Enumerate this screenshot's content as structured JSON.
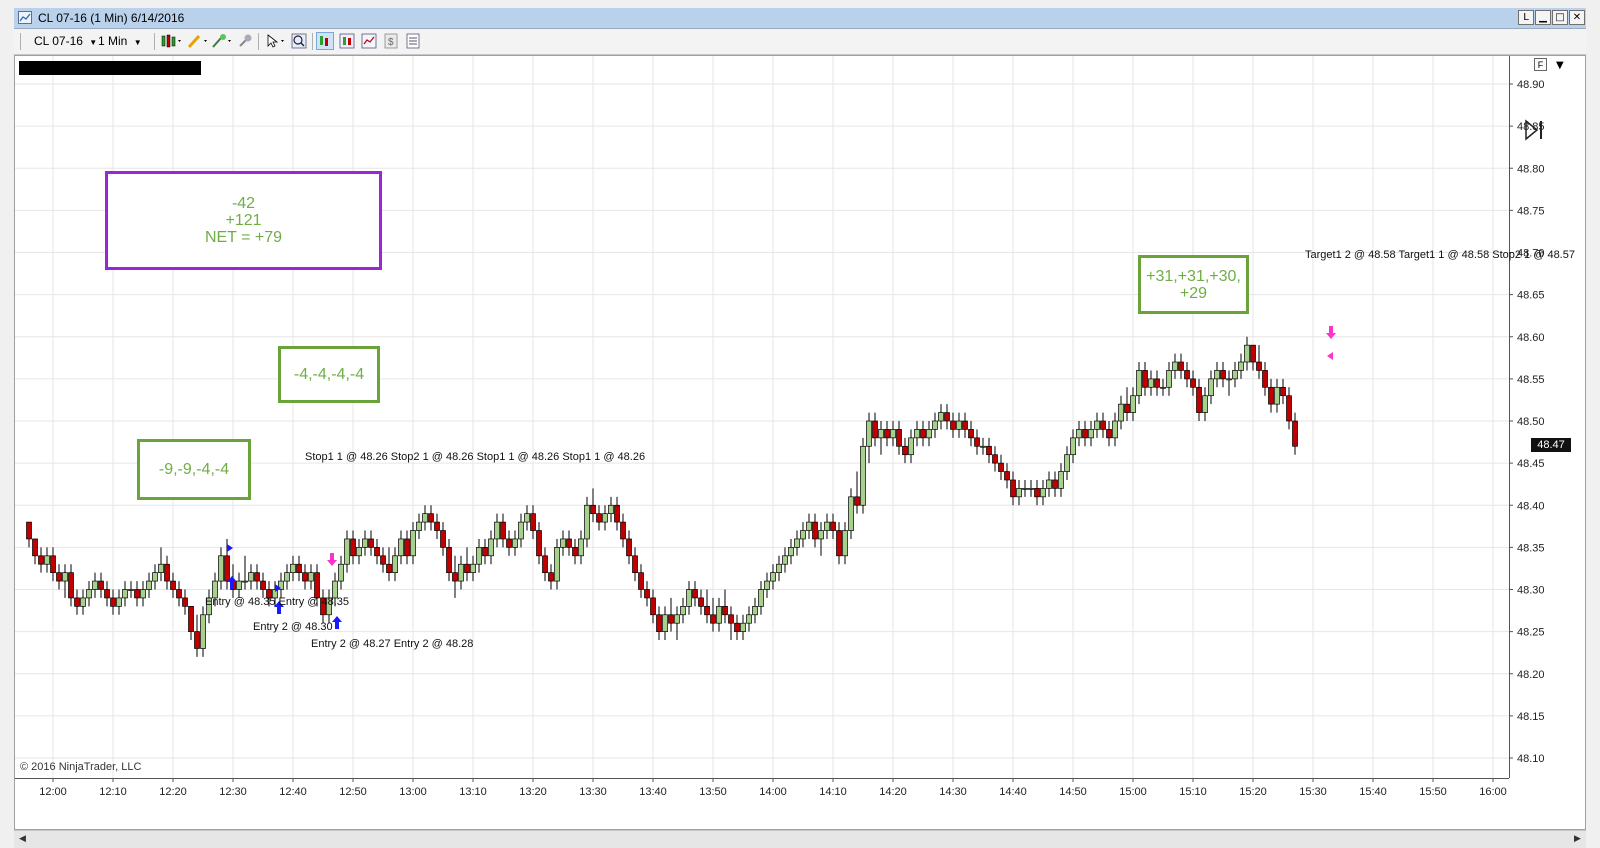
{
  "window": {
    "title": "CL 07-16 (1 Min)  6/14/2016",
    "buttons": {
      "link": "L",
      "minimize": "▁",
      "maximize": "□",
      "close": "✕"
    }
  },
  "toolbar": {
    "instrument": "CL 07-16",
    "interval": "1 Min",
    "icons": [
      "bar-type-icon",
      "pencil-draw-icon",
      "magic-wand-icon",
      "pin-icon",
      "cursor-select-icon",
      "zoom-icon",
      "data-box-icon",
      "chart-style-icon",
      "indicator-icon",
      "strategy-icon",
      "properties-icon"
    ]
  },
  "chart": {
    "copyright": "© 2016 NinjaTrader, LLC",
    "current_price": "48.47",
    "format_button": "F",
    "y_ticks": [
      "48.90",
      "48.85",
      "48.80",
      "48.75",
      "48.70",
      "48.65",
      "48.60",
      "48.55",
      "48.50",
      "48.45",
      "48.40",
      "48.35",
      "48.30",
      "48.25",
      "48.20",
      "48.15",
      "48.10"
    ],
    "x_ticks": [
      "12:00",
      "12:10",
      "12:20",
      "12:30",
      "12:40",
      "12:50",
      "13:00",
      "13:10",
      "13:20",
      "13:30",
      "13:40",
      "13:50",
      "14:00",
      "14:10",
      "14:20",
      "14:30",
      "14:40",
      "14:50",
      "15:00",
      "15:10",
      "15:20",
      "15:30",
      "15:40",
      "15:50",
      "16:00"
    ],
    "colors": {
      "up": "#a8d08d",
      "down": "#c00000",
      "grid": "#e6e6e6",
      "entry": "#1a1aff",
      "exit": "#ff33cc"
    }
  },
  "chart_data": {
    "type": "candlestick",
    "x_unit": "minute bars, starting 11:56",
    "ylim": [
      48.08,
      48.92
    ],
    "candles": [
      [
        48.38,
        48.38,
        48.35,
        48.36
      ],
      [
        48.36,
        48.36,
        48.33,
        48.34
      ],
      [
        48.34,
        48.35,
        48.32,
        48.33
      ],
      [
        48.33,
        48.35,
        48.32,
        48.34
      ],
      [
        48.34,
        48.35,
        48.31,
        48.32
      ],
      [
        48.32,
        48.33,
        48.3,
        48.31
      ],
      [
        48.31,
        48.33,
        48.29,
        48.32
      ],
      [
        48.32,
        48.33,
        48.28,
        48.29
      ],
      [
        48.29,
        48.3,
        48.27,
        48.28
      ],
      [
        48.28,
        48.3,
        48.27,
        48.29
      ],
      [
        48.29,
        48.31,
        48.28,
        48.3
      ],
      [
        48.3,
        48.32,
        48.29,
        48.31
      ],
      [
        48.31,
        48.32,
        48.29,
        48.3
      ],
      [
        48.3,
        48.31,
        48.28,
        48.29
      ],
      [
        48.29,
        48.3,
        48.27,
        48.28
      ],
      [
        48.28,
        48.3,
        48.27,
        48.29
      ],
      [
        48.29,
        48.31,
        48.28,
        48.3
      ],
      [
        48.3,
        48.31,
        48.29,
        48.3
      ],
      [
        48.3,
        48.31,
        48.28,
        48.29
      ],
      [
        48.29,
        48.31,
        48.28,
        48.3
      ],
      [
        48.3,
        48.32,
        48.29,
        48.31
      ],
      [
        48.31,
        48.33,
        48.3,
        48.32
      ],
      [
        48.32,
        48.35,
        48.31,
        48.33
      ],
      [
        48.33,
        48.34,
        48.3,
        48.31
      ],
      [
        48.31,
        48.32,
        48.29,
        48.3
      ],
      [
        48.3,
        48.31,
        48.28,
        48.29
      ],
      [
        48.29,
        48.3,
        48.27,
        48.28
      ],
      [
        48.28,
        48.28,
        48.24,
        48.25
      ],
      [
        48.25,
        48.27,
        48.22,
        48.23
      ],
      [
        48.23,
        48.28,
        48.22,
        48.27
      ],
      [
        48.27,
        48.3,
        48.26,
        48.29
      ],
      [
        48.29,
        48.32,
        48.28,
        48.31
      ],
      [
        48.31,
        48.35,
        48.3,
        48.34
      ],
      [
        48.34,
        48.36,
        48.3,
        48.31
      ],
      [
        48.31,
        48.33,
        48.29,
        48.3
      ],
      [
        48.3,
        48.32,
        48.29,
        48.31
      ],
      [
        48.31,
        48.34,
        48.3,
        48.31
      ],
      [
        48.31,
        48.33,
        48.3,
        48.32
      ],
      [
        48.32,
        48.33,
        48.3,
        48.31
      ],
      [
        48.31,
        48.32,
        48.29,
        48.3
      ],
      [
        48.3,
        48.31,
        48.28,
        48.29
      ],
      [
        48.29,
        48.31,
        48.28,
        48.3
      ],
      [
        48.3,
        48.32,
        48.29,
        48.31
      ],
      [
        48.31,
        48.33,
        48.3,
        48.32
      ],
      [
        48.32,
        48.34,
        48.31,
        48.33
      ],
      [
        48.33,
        48.34,
        48.31,
        48.32
      ],
      [
        48.32,
        48.33,
        48.3,
        48.31
      ],
      [
        48.31,
        48.33,
        48.3,
        48.32
      ],
      [
        48.32,
        48.33,
        48.28,
        48.29
      ],
      [
        48.29,
        48.3,
        48.26,
        48.27
      ],
      [
        48.27,
        48.3,
        48.26,
        48.29
      ],
      [
        48.29,
        48.32,
        48.28,
        48.31
      ],
      [
        48.31,
        48.34,
        48.3,
        48.33
      ],
      [
        48.33,
        48.37,
        48.32,
        48.36
      ],
      [
        48.36,
        48.37,
        48.33,
        48.34
      ],
      [
        48.34,
        48.36,
        48.33,
        48.35
      ],
      [
        48.35,
        48.37,
        48.34,
        48.36
      ],
      [
        48.36,
        48.37,
        48.34,
        48.35
      ],
      [
        48.35,
        48.36,
        48.33,
        48.34
      ],
      [
        48.34,
        48.35,
        48.32,
        48.33
      ],
      [
        48.33,
        48.35,
        48.31,
        48.32
      ],
      [
        48.32,
        48.35,
        48.31,
        48.34
      ],
      [
        48.34,
        48.37,
        48.33,
        48.36
      ],
      [
        48.36,
        48.37,
        48.33,
        48.34
      ],
      [
        48.34,
        48.38,
        48.33,
        48.37
      ],
      [
        48.37,
        48.39,
        48.36,
        48.38
      ],
      [
        48.38,
        48.4,
        48.37,
        48.39
      ],
      [
        48.39,
        48.4,
        48.37,
        48.38
      ],
      [
        48.38,
        48.39,
        48.36,
        48.37
      ],
      [
        48.37,
        48.38,
        48.34,
        48.35
      ],
      [
        48.35,
        48.36,
        48.31,
        48.32
      ],
      [
        48.32,
        48.34,
        48.29,
        48.31
      ],
      [
        48.31,
        48.34,
        48.3,
        48.33
      ],
      [
        48.33,
        48.35,
        48.31,
        48.32
      ],
      [
        48.32,
        48.34,
        48.31,
        48.33
      ],
      [
        48.33,
        48.36,
        48.32,
        48.35
      ],
      [
        48.35,
        48.36,
        48.33,
        48.34
      ],
      [
        48.34,
        48.37,
        48.33,
        48.36
      ],
      [
        48.36,
        48.39,
        48.35,
        48.38
      ],
      [
        48.38,
        48.39,
        48.35,
        48.36
      ],
      [
        48.36,
        48.37,
        48.34,
        48.35
      ],
      [
        48.35,
        48.37,
        48.34,
        48.36
      ],
      [
        48.36,
        48.39,
        48.35,
        48.38
      ],
      [
        48.38,
        48.4,
        48.37,
        48.39
      ],
      [
        48.39,
        48.4,
        48.36,
        48.37
      ],
      [
        48.37,
        48.38,
        48.33,
        48.34
      ],
      [
        48.34,
        48.35,
        48.31,
        48.32
      ],
      [
        48.32,
        48.33,
        48.3,
        48.31
      ],
      [
        48.31,
        48.36,
        48.3,
        48.35
      ],
      [
        48.35,
        48.37,
        48.34,
        48.36
      ],
      [
        48.36,
        48.37,
        48.34,
        48.35
      ],
      [
        48.35,
        48.36,
        48.33,
        48.34
      ],
      [
        48.34,
        48.37,
        48.33,
        48.36
      ],
      [
        48.36,
        48.41,
        48.35,
        48.4
      ],
      [
        48.4,
        48.42,
        48.38,
        48.39
      ],
      [
        48.39,
        48.4,
        48.37,
        48.38
      ],
      [
        48.38,
        48.4,
        48.37,
        48.39
      ],
      [
        48.39,
        48.41,
        48.38,
        48.4
      ],
      [
        48.4,
        48.41,
        48.37,
        48.38
      ],
      [
        48.38,
        48.39,
        48.35,
        48.36
      ],
      [
        48.36,
        48.37,
        48.33,
        48.34
      ],
      [
        48.34,
        48.35,
        48.31,
        48.32
      ],
      [
        48.32,
        48.33,
        48.29,
        48.3
      ],
      [
        48.3,
        48.31,
        48.28,
        48.29
      ],
      [
        48.29,
        48.3,
        48.26,
        48.27
      ],
      [
        48.27,
        48.28,
        48.24,
        48.25
      ],
      [
        48.25,
        48.28,
        48.24,
        48.27
      ],
      [
        48.27,
        48.29,
        48.25,
        48.26
      ],
      [
        48.26,
        48.28,
        48.24,
        48.27
      ],
      [
        48.27,
        48.29,
        48.26,
        48.28
      ],
      [
        48.28,
        48.31,
        48.27,
        48.3
      ],
      [
        48.3,
        48.31,
        48.28,
        48.29
      ],
      [
        48.29,
        48.3,
        48.27,
        48.28
      ],
      [
        48.28,
        48.3,
        48.26,
        48.27
      ],
      [
        48.27,
        48.29,
        48.25,
        48.26
      ],
      [
        48.26,
        48.29,
        48.25,
        48.28
      ],
      [
        48.28,
        48.3,
        48.26,
        48.27
      ],
      [
        48.27,
        48.28,
        48.24,
        48.26
      ],
      [
        48.26,
        48.27,
        48.24,
        48.25
      ],
      [
        48.25,
        48.27,
        48.24,
        48.26
      ],
      [
        48.26,
        48.28,
        48.25,
        48.27
      ],
      [
        48.27,
        48.29,
        48.26,
        48.28
      ],
      [
        48.28,
        48.31,
        48.27,
        48.3
      ],
      [
        48.3,
        48.32,
        48.29,
        48.31
      ],
      [
        48.31,
        48.33,
        48.3,
        48.32
      ],
      [
        48.32,
        48.34,
        48.31,
        48.33
      ],
      [
        48.33,
        48.35,
        48.32,
        48.34
      ],
      [
        48.34,
        48.36,
        48.33,
        48.35
      ],
      [
        48.35,
        48.37,
        48.34,
        48.36
      ],
      [
        48.36,
        48.38,
        48.35,
        48.37
      ],
      [
        48.37,
        48.39,
        48.36,
        48.38
      ],
      [
        48.38,
        48.39,
        48.35,
        48.36
      ],
      [
        48.36,
        48.38,
        48.34,
        48.37
      ],
      [
        48.37,
        48.39,
        48.36,
        48.38
      ],
      [
        48.38,
        48.39,
        48.36,
        48.37
      ],
      [
        48.37,
        48.38,
        48.33,
        48.34
      ],
      [
        48.34,
        48.38,
        48.33,
        48.37
      ],
      [
        48.37,
        48.42,
        48.36,
        48.41
      ],
      [
        48.41,
        48.44,
        48.39,
        48.4
      ],
      [
        48.4,
        48.48,
        48.39,
        48.47
      ],
      [
        48.47,
        48.51,
        48.45,
        48.5
      ],
      [
        48.5,
        48.51,
        48.47,
        48.48
      ],
      [
        48.48,
        48.5,
        48.46,
        48.49
      ],
      [
        48.49,
        48.5,
        48.47,
        48.48
      ],
      [
        48.48,
        48.5,
        48.47,
        48.49
      ],
      [
        48.49,
        48.5,
        48.46,
        48.47
      ],
      [
        48.47,
        48.48,
        48.45,
        48.46
      ],
      [
        48.46,
        48.49,
        48.45,
        48.48
      ],
      [
        48.48,
        48.5,
        48.47,
        48.49
      ],
      [
        48.49,
        48.5,
        48.47,
        48.48
      ],
      [
        48.48,
        48.5,
        48.47,
        48.49
      ],
      [
        48.49,
        48.51,
        48.48,
        48.5
      ],
      [
        48.5,
        48.52,
        48.49,
        48.51
      ],
      [
        48.51,
        48.52,
        48.49,
        48.5
      ],
      [
        48.5,
        48.51,
        48.48,
        48.49
      ],
      [
        48.49,
        48.51,
        48.48,
        48.5
      ],
      [
        48.5,
        48.51,
        48.48,
        48.49
      ],
      [
        48.49,
        48.5,
        48.47,
        48.48
      ],
      [
        48.48,
        48.49,
        48.46,
        48.47
      ],
      [
        48.47,
        48.48,
        48.46,
        48.47
      ],
      [
        48.47,
        48.48,
        48.45,
        48.46
      ],
      [
        48.46,
        48.47,
        48.44,
        48.45
      ],
      [
        48.45,
        48.46,
        48.43,
        48.44
      ],
      [
        48.44,
        48.45,
        48.42,
        48.43
      ],
      [
        48.43,
        48.44,
        48.4,
        48.41
      ],
      [
        48.41,
        48.43,
        48.4,
        48.42
      ],
      [
        48.42,
        48.43,
        48.41,
        48.42
      ],
      [
        48.42,
        48.43,
        48.41,
        48.42
      ],
      [
        48.42,
        48.43,
        48.4,
        48.41
      ],
      [
        48.41,
        48.43,
        48.4,
        48.42
      ],
      [
        48.42,
        48.44,
        48.41,
        48.43
      ],
      [
        48.43,
        48.44,
        48.41,
        48.42
      ],
      [
        48.42,
        48.45,
        48.41,
        48.44
      ],
      [
        48.44,
        48.47,
        48.43,
        48.46
      ],
      [
        48.46,
        48.49,
        48.45,
        48.48
      ],
      [
        48.48,
        48.5,
        48.47,
        48.49
      ],
      [
        48.49,
        48.5,
        48.47,
        48.48
      ],
      [
        48.48,
        48.5,
        48.47,
        48.49
      ],
      [
        48.49,
        48.51,
        48.48,
        48.5
      ],
      [
        48.5,
        48.51,
        48.48,
        48.49
      ],
      [
        48.49,
        48.5,
        48.47,
        48.48
      ],
      [
        48.48,
        48.51,
        48.47,
        48.5
      ],
      [
        48.5,
        48.53,
        48.49,
        48.52
      ],
      [
        48.52,
        48.54,
        48.5,
        48.51
      ],
      [
        48.51,
        48.54,
        48.5,
        48.53
      ],
      [
        48.53,
        48.57,
        48.52,
        48.56
      ],
      [
        48.56,
        48.57,
        48.53,
        48.54
      ],
      [
        48.54,
        48.56,
        48.53,
        48.55
      ],
      [
        48.55,
        48.56,
        48.53,
        48.54
      ],
      [
        48.54,
        48.55,
        48.53,
        48.54
      ],
      [
        48.54,
        48.57,
        48.53,
        48.56
      ],
      [
        48.56,
        48.58,
        48.55,
        48.57
      ],
      [
        48.57,
        48.58,
        48.55,
        48.56
      ],
      [
        48.56,
        48.57,
        48.54,
        48.55
      ],
      [
        48.55,
        48.56,
        48.53,
        48.54
      ],
      [
        48.54,
        48.55,
        48.5,
        48.51
      ],
      [
        48.51,
        48.54,
        48.5,
        48.53
      ],
      [
        48.53,
        48.56,
        48.52,
        48.55
      ],
      [
        48.55,
        48.57,
        48.54,
        48.56
      ],
      [
        48.56,
        48.57,
        48.54,
        48.55
      ],
      [
        48.55,
        48.56,
        48.53,
        48.55
      ],
      [
        48.55,
        48.57,
        48.54,
        48.56
      ],
      [
        48.56,
        48.58,
        48.55,
        48.57
      ],
      [
        48.57,
        48.6,
        48.56,
        48.59
      ],
      [
        48.59,
        48.59,
        48.56,
        48.57
      ],
      [
        48.57,
        48.59,
        48.55,
        48.56
      ],
      [
        48.56,
        48.57,
        48.53,
        48.54
      ],
      [
        48.54,
        48.55,
        48.51,
        48.52
      ],
      [
        48.52,
        48.55,
        48.51,
        48.54
      ],
      [
        48.54,
        48.55,
        48.52,
        48.53
      ],
      [
        48.53,
        48.54,
        48.49,
        48.5
      ],
      [
        48.5,
        48.51,
        48.46,
        48.47
      ]
    ],
    "annotations": [
      {
        "text": "-42\n+121\nNET = +79"
      },
      {
        "text": "-4,-4,-4,-4"
      },
      {
        "text": "-9,-9,-4,-4"
      },
      {
        "text": "+31,+31,+30,\n+29"
      }
    ],
    "executions": [
      {
        "label": "Entry\n@ 48.35\nEntry\n@ 48.35",
        "side": "buy"
      },
      {
        "label": "Entry\n2 @ 48.30",
        "side": "buy"
      },
      {
        "label": "Stop1\n1 @ 48.26\nStop2\n1 @ 48.26\nStop1\n1 @ 48.26\nStop1\n1 @ 48.26",
        "side": "sell"
      },
      {
        "label": "Entry\n2 @ 48.27\nEntry\n2 @ 48.28",
        "side": "buy"
      },
      {
        "label": "Target1\n2 @ 48.58\nTarget1\n1 @ 48.58\nStop2\n1 @ 48.57",
        "side": "sell"
      }
    ]
  }
}
